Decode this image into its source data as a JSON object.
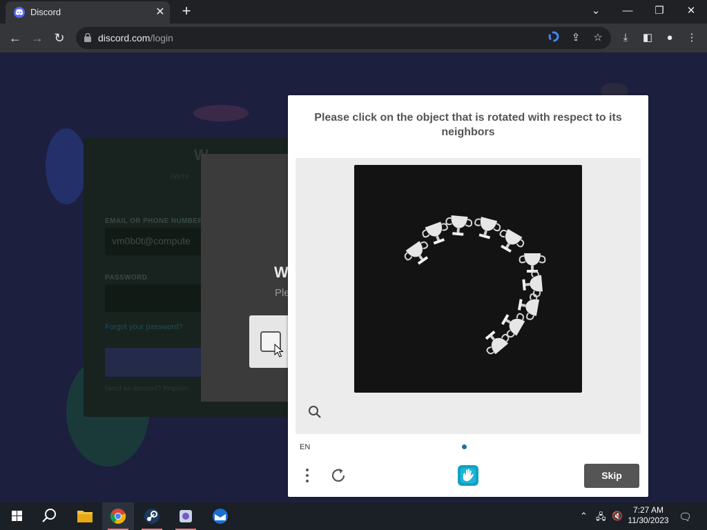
{
  "browser": {
    "tab_title": "Discord",
    "url_host": "discord.com",
    "url_path": "/login",
    "tab_close": "✕",
    "new_tab": "+"
  },
  "login": {
    "title": "W",
    "subtitle": "We're",
    "email_label": "EMAIL OR PHONE NUMBER",
    "email_value": "vm0b0t@compute",
    "password_label": "PASSWORD",
    "forgot_link": "Forgot your password?",
    "need_account": "Need an account? Register"
  },
  "verify": {
    "title": "W",
    "subtitle": "Ple"
  },
  "captcha": {
    "prompt": "Please click on the object that is rotated with respect to its neighbors",
    "language": "EN",
    "skip_label": "Skip",
    "colors": {
      "skip_bg": "#555555",
      "dot": "#1f6fa0",
      "image_bg": "#131313"
    }
  },
  "taskbar": {
    "time": "7:27 AM",
    "date": "11/30/2023"
  }
}
